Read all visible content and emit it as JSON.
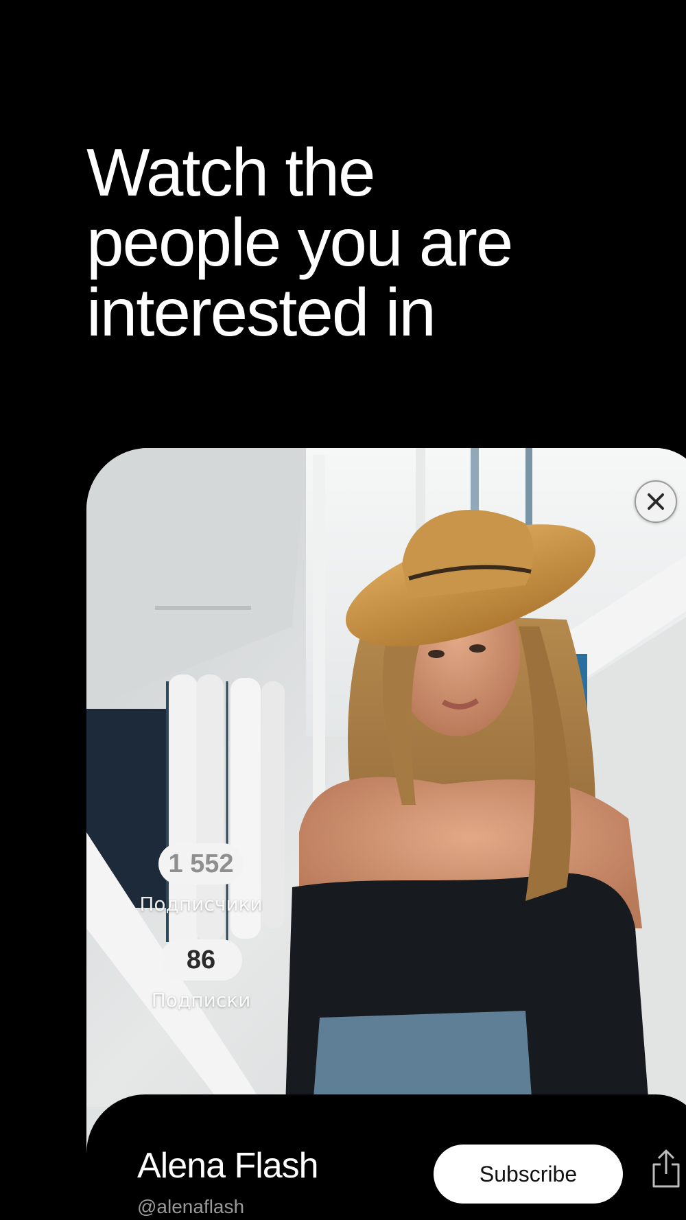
{
  "headline": {
    "line1": "Watch the",
    "line2": "people you are",
    "line3": "interested in"
  },
  "card": {
    "photo_icon": "profile-photo",
    "close_icon": "close-icon",
    "stats": {
      "followers_count": "1 552",
      "followers_label": "Подписчики",
      "following_count": "86",
      "following_label": "Подписки"
    },
    "profile": {
      "name": "Alena Flash",
      "handle": "@alenaflash",
      "subscribe_label": "Subscribe",
      "share_icon": "share-icon"
    }
  },
  "colors": {
    "background": "#000000",
    "text": "#ffffff",
    "button_bg": "#ffffff",
    "pill_bg": "#f3f3f3"
  }
}
